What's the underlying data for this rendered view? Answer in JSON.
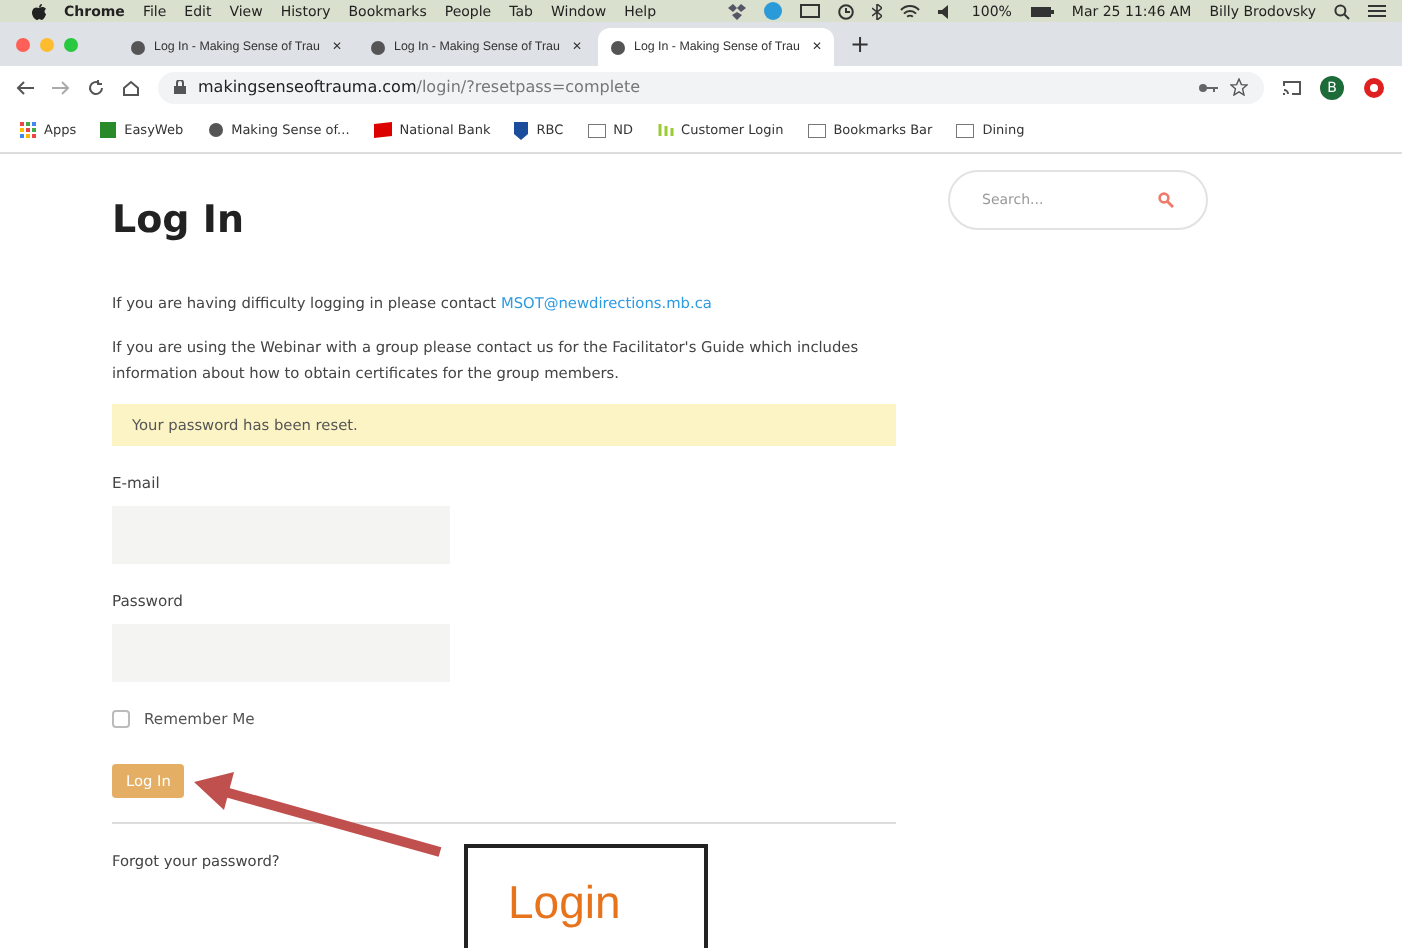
{
  "menu_bar": {
    "app": "Chrome",
    "items": [
      "File",
      "Edit",
      "View",
      "History",
      "Bookmarks",
      "People",
      "Tab",
      "Window",
      "Help"
    ],
    "battery": "100%",
    "clock": "Mar 25 11:46 AM",
    "user": "Billy Brodovsky"
  },
  "tabs": [
    {
      "title": "Log In - Making Sense of Trau",
      "close": "✕",
      "selected": false
    },
    {
      "title": "Log In - Making Sense of Trau",
      "close": "✕",
      "selected": false
    },
    {
      "title": "Log In - Making Sense of Trau",
      "close": "✕",
      "selected": true
    }
  ],
  "new_tab": "+",
  "address": {
    "host": "makingsenseoftrauma.com",
    "path": "/login/?resetpass=complete",
    "profile": "B"
  },
  "bookmarks": [
    {
      "label": "Apps",
      "kind": "apps"
    },
    {
      "label": "EasyWeb",
      "kind": "td"
    },
    {
      "label": "Making Sense of...",
      "kind": "globe"
    },
    {
      "label": "National Bank",
      "kind": "flag"
    },
    {
      "label": "RBC",
      "kind": "rbc"
    },
    {
      "label": "ND",
      "kind": "folder"
    },
    {
      "label": "Customer Login",
      "kind": "ils"
    },
    {
      "label": "Bookmarks Bar",
      "kind": "folder"
    },
    {
      "label": "Dining",
      "kind": "folder"
    }
  ],
  "page": {
    "title": "Log In",
    "contact_text": "If you are having difficulty logging in please contact ",
    "contact_link": "MSOT@newdirections.mb.ca",
    "webinar_text": "If you are using the Webinar with a group please contact us for the Facilitator's Guide which includes information about how to obtain certificates for the group members.",
    "notice": "Your password has been reset.",
    "email_label": "E-mail",
    "password_label": "Password",
    "remember": {
      "label": "Remember Me",
      "checked": false
    },
    "submit": "Log In",
    "forgot": "Forgot your password?"
  },
  "search": {
    "placeholder": "Search..."
  },
  "annotation": {
    "text": "Login"
  }
}
